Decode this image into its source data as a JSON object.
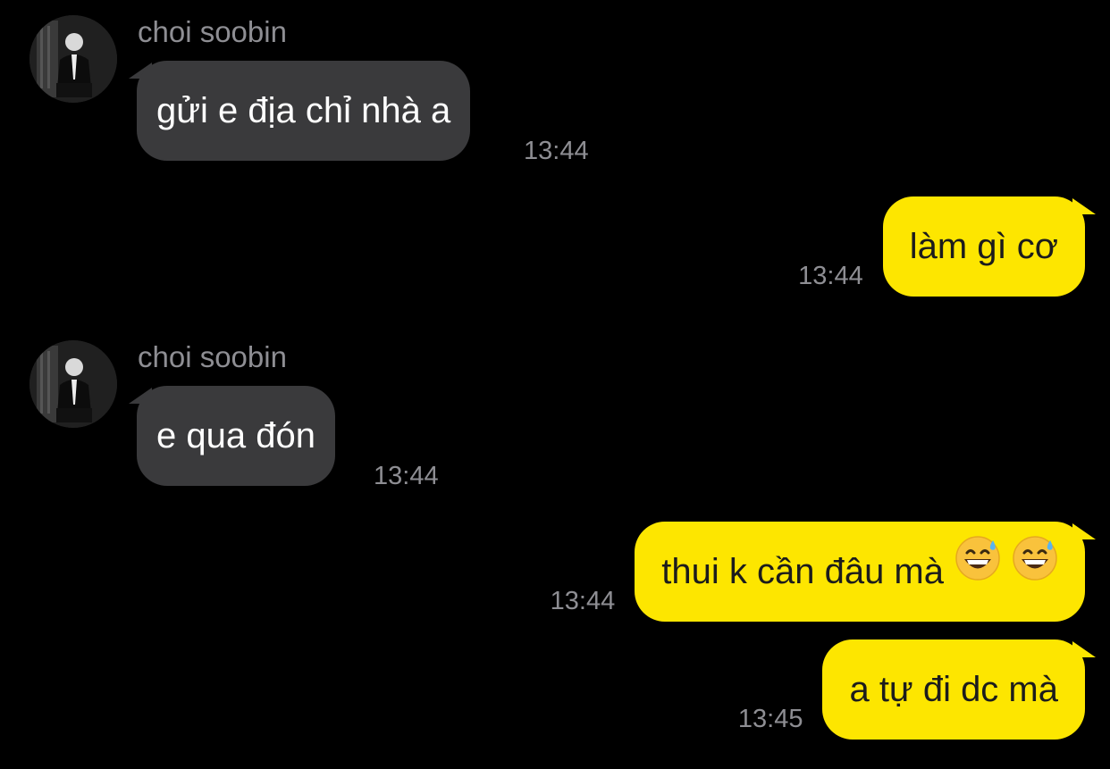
{
  "chat": {
    "messages": [
      {
        "direction": "in",
        "sender": "choi soobin",
        "text": "gửi e địa chỉ nhà a",
        "time": "13:44"
      },
      {
        "direction": "out",
        "text": "làm gì cơ",
        "time": "13:44"
      },
      {
        "direction": "in",
        "sender": "choi soobin",
        "text": "e qua đón",
        "time": "13:44"
      },
      {
        "direction": "out",
        "text": "thui k cần đâu mà",
        "emoji": [
          "grinning-face-with-sweat",
          "grinning-face-with-sweat"
        ],
        "time": "13:44"
      },
      {
        "direction": "out",
        "text": "a tự đi dc mà",
        "time": "13:45"
      }
    ]
  },
  "colors": {
    "background": "#000000",
    "incoming_bubble": "#3a3a3c",
    "outgoing_bubble": "#fde600",
    "meta_text": "#8e8e93"
  }
}
